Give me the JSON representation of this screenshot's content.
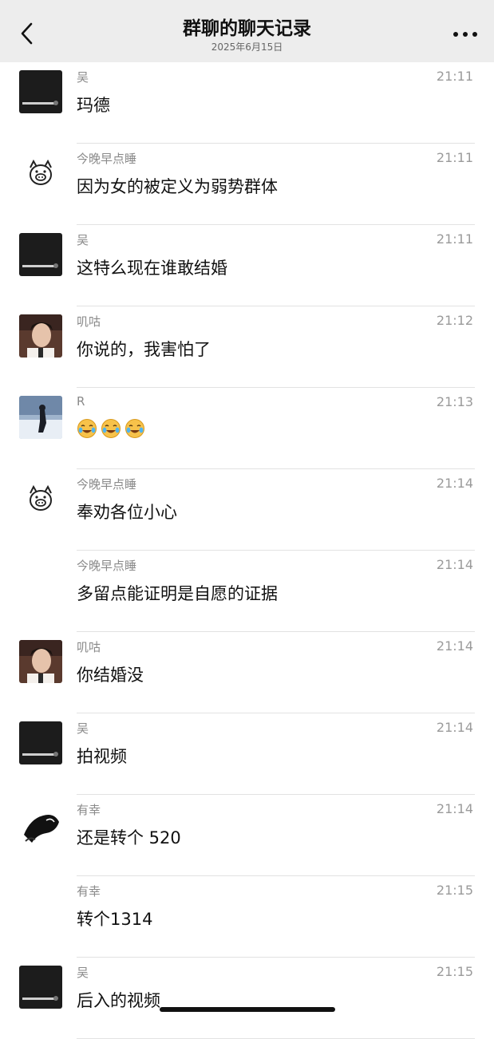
{
  "header": {
    "title": "群聊的聊天记录",
    "subtitle": "2025年6月15日",
    "back_icon": "chevron-left-icon",
    "more_icon": "more-dots-icon"
  },
  "messages": [
    {
      "name": "吴",
      "time": "21:11",
      "text": "玛德",
      "avatar": "dark"
    },
    {
      "name": "今晚早点睡",
      "time": "21:11",
      "text": "因为女的被定义为弱势群体",
      "avatar": "pig"
    },
    {
      "name": "吴",
      "time": "21:11",
      "text": "这特么现在谁敢结婚",
      "avatar": "dark"
    },
    {
      "name": "叽咕",
      "time": "21:12",
      "text": "你说的，我害怕了",
      "avatar": "photo"
    },
    {
      "name": "R",
      "time": "21:13",
      "text": "",
      "avatar": "snow",
      "emojis": [
        "crying-laughing-emoji",
        "crying-laughing-emoji",
        "crying-laughing-emoji"
      ]
    },
    {
      "name": "今晚早点睡",
      "time": "21:14",
      "text": "奉劝各位小心",
      "avatar": "pig"
    },
    {
      "name": "今晚早点睡",
      "time": "21:14",
      "text": "多留点能证明是自愿的证据",
      "avatar": "none"
    },
    {
      "name": "叽咕",
      "time": "21:14",
      "text": "你结婚没",
      "avatar": "photo"
    },
    {
      "name": "吴",
      "time": "21:14",
      "text": "拍视频",
      "avatar": "dark"
    },
    {
      "name": "有幸",
      "time": "21:14",
      "text": "还是转个 520",
      "avatar": "art"
    },
    {
      "name": "有幸",
      "time": "21:15",
      "text": "转个1314",
      "avatar": "none"
    },
    {
      "name": "吴",
      "time": "21:15",
      "text": "后入的视频",
      "avatar": "dark"
    }
  ]
}
